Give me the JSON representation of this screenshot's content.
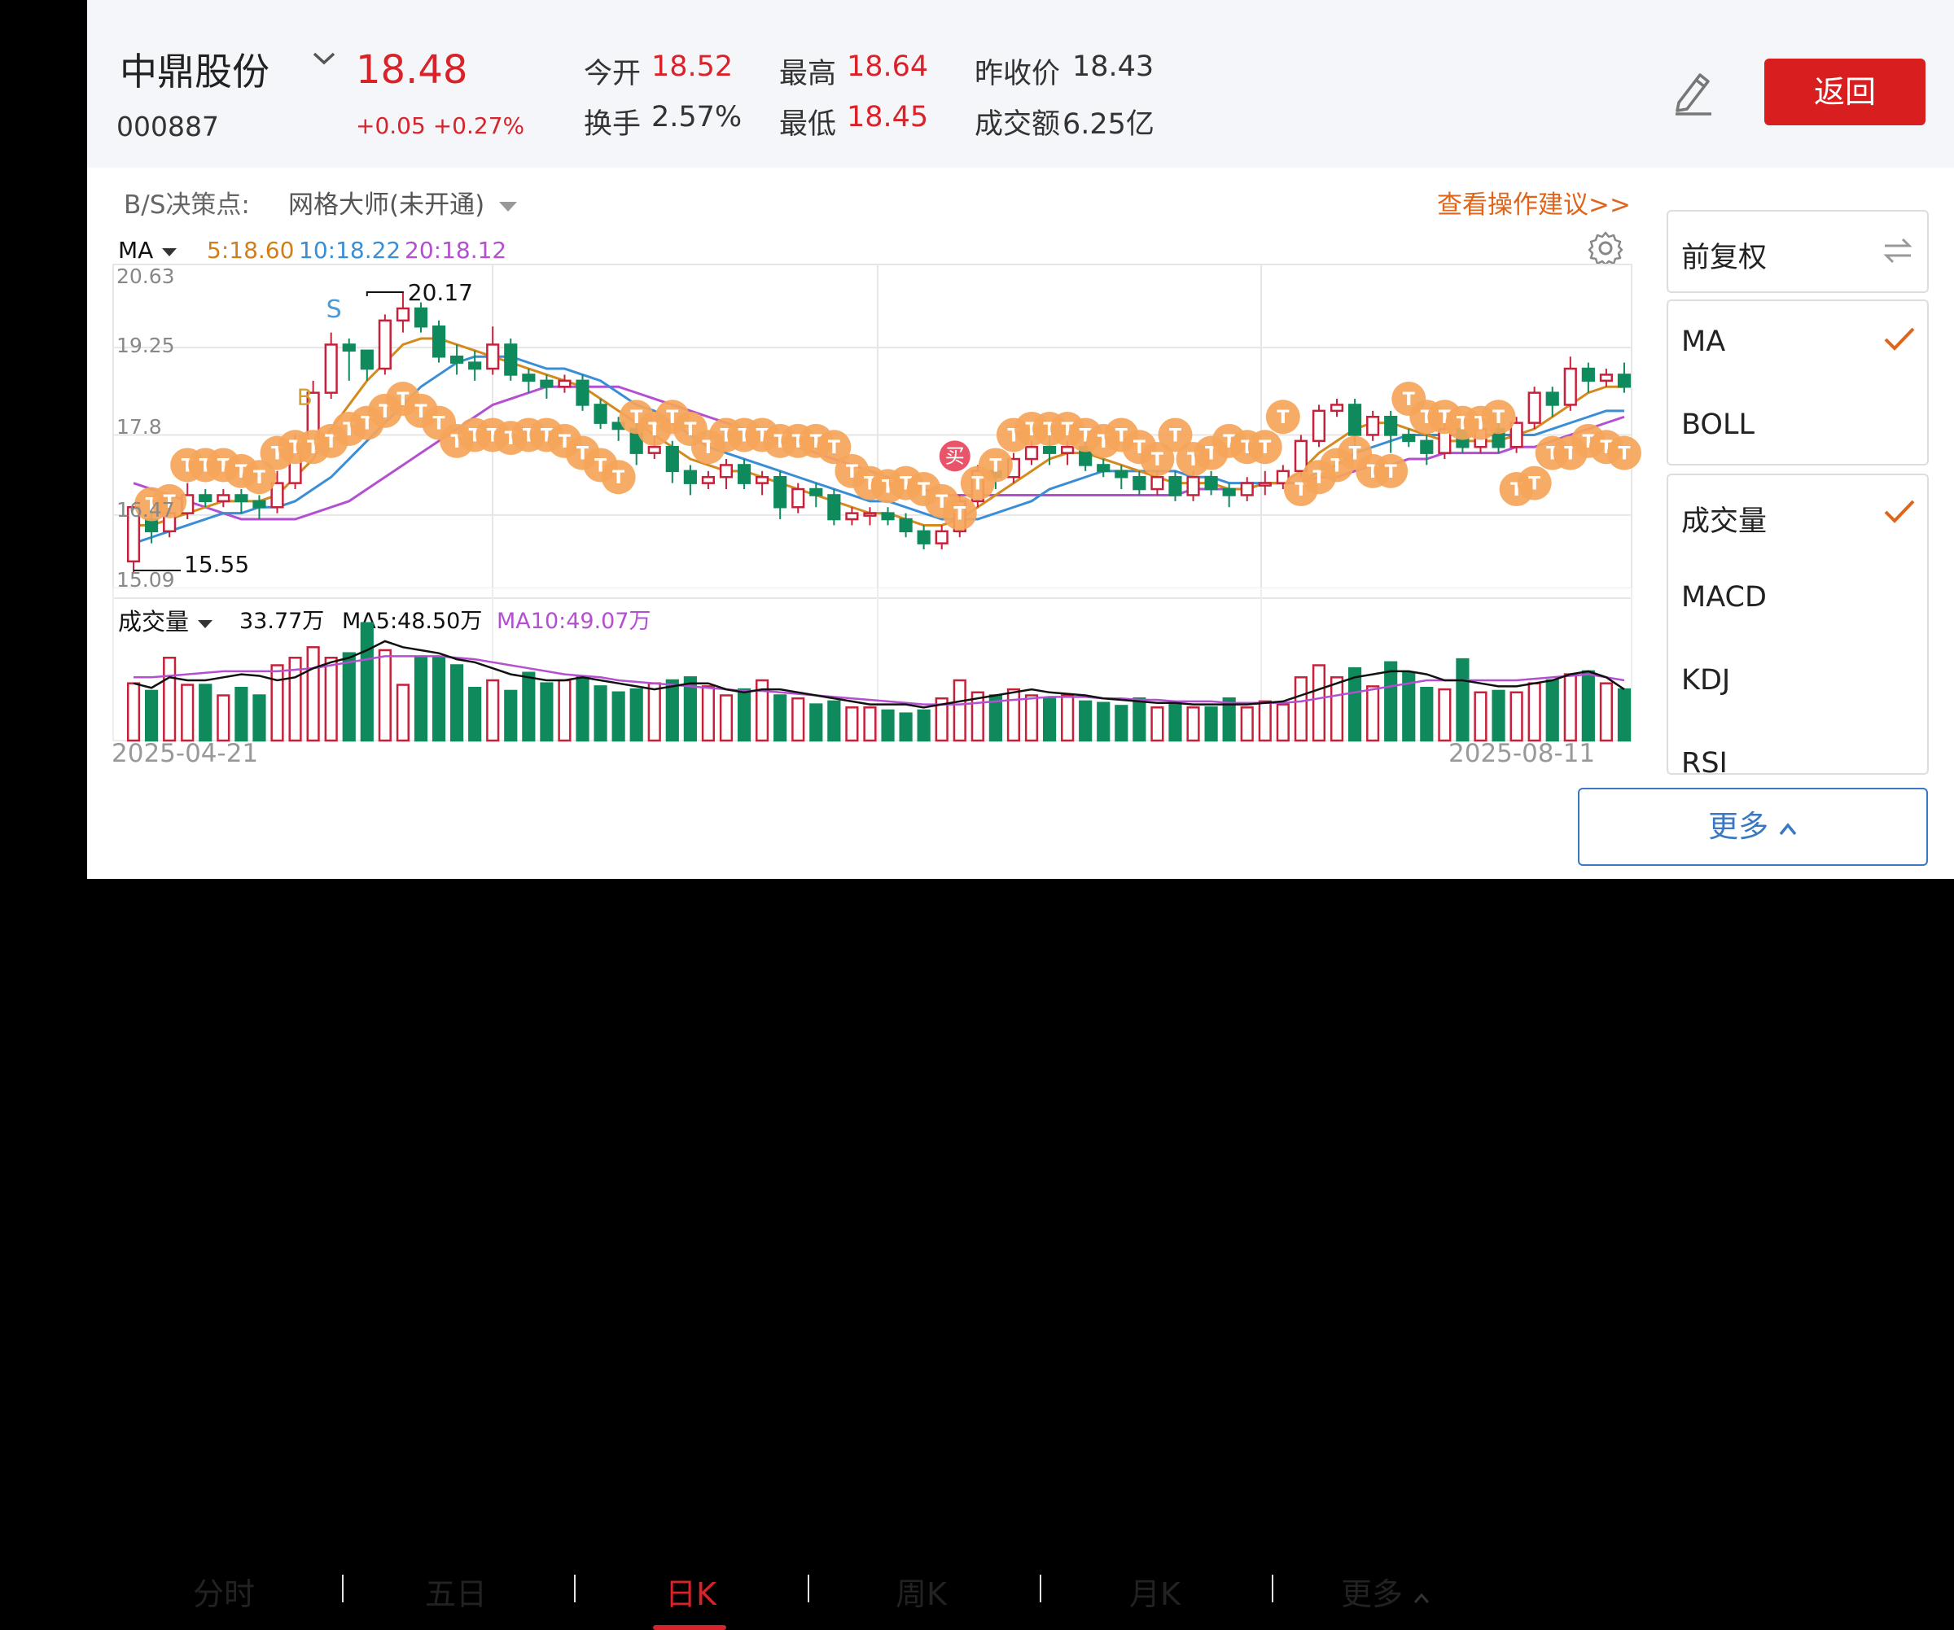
{
  "stock": {
    "name": "中鼎股份",
    "code": "000887",
    "price": "18.48",
    "change": "+0.05 +0.27%"
  },
  "stats": {
    "open_label": "今开",
    "open_value": "18.52",
    "high_label": "最高",
    "high_value": "18.64",
    "prev_close_label": "昨收价",
    "prev_close_value": "18.43",
    "turnover_label": "换手",
    "turnover_value": "2.57%",
    "low_label": "最低",
    "low_value": "18.45",
    "amount_label": "成交额",
    "amount_value": "6.25亿"
  },
  "header": {
    "back_label": "返回"
  },
  "decision": {
    "label": "B/S决策点:",
    "value": "网格大师(未开通)",
    "advice_link": "查看操作建议>>"
  },
  "indicator": {
    "name": "MA",
    "ma5": "5:18.60",
    "ma10": "10:18.22",
    "ma20": "20:18.12"
  },
  "chart_data": {
    "type": "candlestick",
    "y_ticks": [
      "20.63",
      "19.25",
      "17.8",
      "16.47",
      "15.09"
    ],
    "ylim": [
      15.09,
      20.63
    ],
    "max_label": "20.17",
    "min_label": "15.55",
    "markers": {
      "sell": "S",
      "buy": "B",
      "buy_badge": "买",
      "t_badge": "T"
    },
    "x_start": "2025-04-21",
    "x_end": "2025-08-11",
    "colors": {
      "up": "#c6213a",
      "down": "#0e8a5c",
      "ma5": "#d58a1f",
      "ma10": "#3a8ed6",
      "ma20": "#b44fd1",
      "t_marker": "#f5a55a",
      "buy_badge": "#e8556a"
    },
    "candles": [
      [
        15.7,
        16.6,
        15.5,
        16.4
      ],
      [
        16.4,
        16.2,
        16.0,
        16.5
      ],
      [
        16.2,
        16.5,
        16.1,
        16.7
      ],
      [
        16.5,
        16.8,
        16.4,
        17.0
      ],
      [
        16.8,
        16.7,
        16.6,
        16.9
      ],
      [
        16.7,
        16.8,
        16.6,
        16.9
      ],
      [
        16.8,
        16.7,
        16.5,
        16.9
      ],
      [
        16.7,
        16.6,
        16.4,
        16.8
      ],
      [
        16.6,
        17.0,
        16.5,
        17.2
      ],
      [
        17.0,
        17.6,
        16.9,
        17.8
      ],
      [
        17.6,
        18.5,
        17.5,
        18.7
      ],
      [
        18.5,
        19.3,
        18.4,
        19.5
      ],
      [
        19.3,
        19.2,
        18.7,
        19.4
      ],
      [
        19.2,
        18.9,
        18.7,
        19.2
      ],
      [
        18.9,
        19.7,
        18.8,
        19.8
      ],
      [
        19.7,
        19.9,
        19.5,
        20.17
      ],
      [
        19.9,
        19.6,
        19.5,
        20.0
      ],
      [
        19.6,
        19.1,
        19.0,
        19.7
      ],
      [
        19.1,
        19.0,
        18.8,
        19.3
      ],
      [
        19.0,
        18.9,
        18.7,
        19.2
      ],
      [
        18.9,
        19.3,
        18.8,
        19.6
      ],
      [
        19.3,
        18.8,
        18.7,
        19.4
      ],
      [
        18.8,
        18.7,
        18.5,
        18.9
      ],
      [
        18.7,
        18.6,
        18.4,
        18.8
      ],
      [
        18.6,
        18.7,
        18.5,
        18.8
      ],
      [
        18.7,
        18.3,
        18.2,
        18.8
      ],
      [
        18.3,
        18.0,
        17.9,
        18.4
      ],
      [
        18.0,
        17.9,
        17.7,
        18.1
      ],
      [
        17.9,
        17.5,
        17.3,
        18.0
      ],
      [
        17.5,
        17.6,
        17.4,
        17.8
      ],
      [
        17.6,
        17.2,
        17.0,
        17.7
      ],
      [
        17.2,
        17.0,
        16.8,
        17.3
      ],
      [
        17.0,
        17.1,
        16.9,
        17.2
      ],
      [
        17.1,
        17.3,
        16.9,
        17.4
      ],
      [
        17.3,
        17.0,
        16.9,
        17.4
      ],
      [
        17.0,
        17.1,
        16.8,
        17.2
      ],
      [
        17.1,
        16.6,
        16.4,
        17.2
      ],
      [
        16.6,
        16.9,
        16.5,
        17.0
      ],
      [
        16.9,
        16.8,
        16.6,
        17.0
      ],
      [
        16.8,
        16.4,
        16.3,
        16.9
      ],
      [
        16.4,
        16.5,
        16.3,
        16.6
      ],
      [
        16.5,
        16.5,
        16.3,
        16.6
      ],
      [
        16.5,
        16.4,
        16.3,
        16.6
      ],
      [
        16.4,
        16.2,
        16.1,
        16.5
      ],
      [
        16.2,
        16.0,
        15.9,
        16.3
      ],
      [
        16.0,
        16.2,
        15.9,
        16.3
      ],
      [
        16.2,
        16.7,
        16.1,
        16.8
      ],
      [
        16.7,
        17.2,
        16.6,
        17.3
      ],
      [
        17.2,
        17.1,
        16.9,
        17.4
      ],
      [
        17.1,
        17.4,
        17.0,
        17.5
      ],
      [
        17.4,
        17.6,
        17.3,
        17.7
      ],
      [
        17.6,
        17.5,
        17.3,
        17.8
      ],
      [
        17.5,
        17.6,
        17.3,
        17.7
      ],
      [
        17.6,
        17.3,
        17.2,
        17.7
      ],
      [
        17.3,
        17.2,
        17.1,
        17.4
      ],
      [
        17.2,
        17.1,
        16.9,
        17.3
      ],
      [
        17.1,
        16.9,
        16.8,
        17.2
      ],
      [
        16.9,
        17.1,
        16.8,
        17.2
      ],
      [
        17.1,
        16.8,
        16.7,
        17.2
      ],
      [
        16.8,
        17.1,
        16.7,
        17.2
      ],
      [
        17.1,
        16.9,
        16.8,
        17.2
      ],
      [
        16.9,
        16.8,
        16.6,
        17.0
      ],
      [
        16.8,
        17.0,
        16.7,
        17.1
      ],
      [
        17.0,
        17.0,
        16.8,
        17.2
      ],
      [
        17.0,
        17.2,
        16.9,
        17.3
      ],
      [
        17.2,
        17.7,
        17.1,
        17.8
      ],
      [
        17.7,
        18.2,
        17.6,
        18.3
      ],
      [
        18.2,
        18.3,
        18.1,
        18.4
      ],
      [
        18.3,
        17.8,
        17.6,
        18.4
      ],
      [
        17.8,
        18.1,
        17.7,
        18.2
      ],
      [
        18.1,
        17.8,
        17.5,
        18.2
      ],
      [
        17.8,
        17.7,
        17.6,
        17.9
      ],
      [
        17.7,
        17.5,
        17.3,
        17.8
      ],
      [
        17.5,
        17.9,
        17.4,
        18.0
      ],
      [
        17.9,
        17.6,
        17.5,
        18.0
      ],
      [
        17.6,
        17.9,
        17.5,
        18.1
      ],
      [
        17.9,
        17.6,
        17.5,
        18.0
      ],
      [
        17.6,
        18.0,
        17.5,
        18.1
      ],
      [
        18.0,
        18.5,
        17.9,
        18.6
      ],
      [
        18.5,
        18.3,
        18.1,
        18.6
      ],
      [
        18.3,
        18.9,
        18.2,
        19.1
      ],
      [
        18.9,
        18.7,
        18.5,
        19.0
      ],
      [
        18.7,
        18.8,
        18.6,
        18.9
      ],
      [
        18.8,
        18.6,
        18.5,
        19.0
      ]
    ],
    "ma5": [
      16.3,
      16.3,
      16.4,
      16.5,
      16.6,
      16.7,
      16.7,
      16.7,
      16.8,
      17.1,
      17.4,
      17.9,
      18.3,
      18.7,
      19.0,
      19.3,
      19.4,
      19.4,
      19.3,
      19.2,
      19.1,
      19.0,
      18.9,
      18.8,
      18.7,
      18.6,
      18.4,
      18.2,
      18.0,
      17.8,
      17.6,
      17.4,
      17.3,
      17.2,
      17.2,
      17.1,
      17.0,
      16.9,
      16.8,
      16.7,
      16.6,
      16.5,
      16.5,
      16.4,
      16.3,
      16.3,
      16.4,
      16.6,
      16.8,
      17.0,
      17.2,
      17.4,
      17.5,
      17.5,
      17.4,
      17.3,
      17.2,
      17.1,
      17.0,
      17.0,
      17.0,
      16.9,
      16.9,
      17.0,
      17.0,
      17.2,
      17.5,
      17.7,
      17.9,
      18.0,
      18.0,
      17.9,
      17.8,
      17.7,
      17.7,
      17.7,
      17.7,
      17.8,
      17.9,
      18.1,
      18.3,
      18.5,
      18.6,
      18.6
    ],
    "ma10": [
      16.0,
      16.1,
      16.2,
      16.3,
      16.4,
      16.5,
      16.5,
      16.6,
      16.6,
      16.7,
      16.9,
      17.1,
      17.4,
      17.7,
      18.0,
      18.3,
      18.6,
      18.8,
      19.0,
      19.1,
      19.1,
      19.1,
      19.0,
      18.9,
      18.9,
      18.8,
      18.7,
      18.5,
      18.3,
      18.2,
      18.0,
      17.8,
      17.6,
      17.5,
      17.4,
      17.3,
      17.2,
      17.1,
      17.0,
      16.9,
      16.8,
      16.7,
      16.7,
      16.6,
      16.5,
      16.4,
      16.4,
      16.4,
      16.5,
      16.6,
      16.7,
      16.9,
      17.0,
      17.1,
      17.2,
      17.2,
      17.2,
      17.2,
      17.2,
      17.1,
      17.1,
      17.0,
      17.0,
      17.0,
      17.0,
      17.0,
      17.2,
      17.3,
      17.5,
      17.6,
      17.7,
      17.8,
      17.8,
      17.8,
      17.8,
      17.8,
      17.8,
      17.8,
      17.8,
      17.9,
      18.0,
      18.1,
      18.2,
      18.2
    ],
    "ma20": [
      17.0,
      16.9,
      16.8,
      16.7,
      16.6,
      16.5,
      16.4,
      16.4,
      16.4,
      16.4,
      16.5,
      16.6,
      16.7,
      16.9,
      17.1,
      17.3,
      17.5,
      17.7,
      17.9,
      18.1,
      18.3,
      18.4,
      18.5,
      18.6,
      18.6,
      18.6,
      18.6,
      18.6,
      18.5,
      18.4,
      18.3,
      18.2,
      18.1,
      18.0,
      17.9,
      17.8,
      17.7,
      17.6,
      17.5,
      17.4,
      17.3,
      17.2,
      17.1,
      17.0,
      16.9,
      16.8,
      16.8,
      16.8,
      16.8,
      16.8,
      16.8,
      16.8,
      16.8,
      16.8,
      16.8,
      16.8,
      16.8,
      16.8,
      16.8,
      16.9,
      16.9,
      16.9,
      16.9,
      17.0,
      17.0,
      17.0,
      17.1,
      17.1,
      17.2,
      17.3,
      17.3,
      17.4,
      17.4,
      17.5,
      17.5,
      17.5,
      17.5,
      17.6,
      17.6,
      17.7,
      17.8,
      17.9,
      18.0,
      18.1
    ],
    "t_markers": [
      [
        1,
        16.65
      ],
      [
        2,
        16.7
      ],
      [
        3,
        17.3
      ],
      [
        4,
        17.3
      ],
      [
        5,
        17.3
      ],
      [
        6,
        17.2
      ],
      [
        7,
        17.1
      ],
      [
        8,
        17.5
      ],
      [
        9,
        17.6
      ],
      [
        10,
        17.6
      ],
      [
        11,
        17.7
      ],
      [
        12,
        17.9
      ],
      [
        13,
        18.0
      ],
      [
        14,
        18.2
      ],
      [
        15,
        18.4
      ],
      [
        16,
        18.2
      ],
      [
        17,
        18.0
      ],
      [
        18,
        17.7
      ],
      [
        19,
        17.8
      ],
      [
        20,
        17.8
      ],
      [
        21,
        17.75
      ],
      [
        22,
        17.8
      ],
      [
        23,
        17.8
      ],
      [
        24,
        17.7
      ],
      [
        25,
        17.5
      ],
      [
        26,
        17.3
      ],
      [
        27,
        17.1
      ],
      [
        28,
        18.1
      ],
      [
        29,
        17.9
      ],
      [
        30,
        18.1
      ],
      [
        31,
        17.9
      ],
      [
        32,
        17.6
      ],
      [
        33,
        17.8
      ],
      [
        34,
        17.8
      ],
      [
        35,
        17.8
      ],
      [
        36,
        17.7
      ],
      [
        37,
        17.7
      ],
      [
        38,
        17.7
      ],
      [
        39,
        17.6
      ],
      [
        40,
        17.2
      ],
      [
        41,
        17.0
      ],
      [
        42,
        16.95
      ],
      [
        43,
        17.0
      ],
      [
        44,
        16.9
      ],
      [
        45,
        16.7
      ],
      [
        46,
        16.5
      ],
      [
        47,
        17.0
      ],
      [
        48,
        17.3
      ],
      [
        49,
        17.8
      ],
      [
        50,
        17.9
      ],
      [
        51,
        17.9
      ],
      [
        52,
        17.9
      ],
      [
        53,
        17.8
      ],
      [
        54,
        17.7
      ],
      [
        55,
        17.8
      ],
      [
        56,
        17.6
      ],
      [
        57,
        17.4
      ],
      [
        58,
        17.8
      ],
      [
        59,
        17.4
      ],
      [
        60,
        17.5
      ],
      [
        61,
        17.7
      ],
      [
        62,
        17.6
      ],
      [
        63,
        17.6
      ],
      [
        64,
        18.1
      ],
      [
        65,
        16.9
      ],
      [
        66,
        17.1
      ],
      [
        67,
        17.3
      ],
      [
        68,
        17.5
      ],
      [
        69,
        17.2
      ],
      [
        70,
        17.2
      ],
      [
        71,
        18.4
      ],
      [
        72,
        18.1
      ],
      [
        73,
        18.1
      ],
      [
        74,
        18.0
      ],
      [
        75,
        18.0
      ],
      [
        76,
        18.1
      ],
      [
        77,
        16.9
      ],
      [
        78,
        17.0
      ],
      [
        79,
        17.5
      ],
      [
        80,
        17.5
      ],
      [
        81,
        17.7
      ],
      [
        82,
        17.6
      ],
      [
        83,
        17.5
      ]
    ],
    "volume": {
      "label": "成交量",
      "current": "33.77万",
      "ma5": "MA5:48.50万",
      "ma10": "MA10:49.07万",
      "ylim": [
        0,
        80
      ],
      "values": [
        38,
        33,
        55,
        37,
        37,
        30,
        35,
        30,
        50,
        55,
        62,
        55,
        58,
        78,
        60,
        37,
        55,
        55,
        50,
        35,
        40,
        33,
        45,
        38,
        40,
        42,
        36,
        32,
        34,
        38,
        40,
        42,
        36,
        30,
        34,
        40,
        30,
        28,
        24,
        26,
        22,
        22,
        20,
        18,
        20,
        28,
        40,
        32,
        30,
        34,
        30,
        28,
        30,
        26,
        25,
        23,
        28,
        22,
        24,
        22,
        22,
        28,
        22,
        26,
        24,
        42,
        50,
        42,
        48,
        36,
        52,
        45,
        35,
        34,
        54,
        32,
        33,
        32,
        38,
        40,
        44,
        46,
        38,
        34
      ],
      "ma5_line": [
        38,
        35,
        42,
        40,
        40,
        42,
        44,
        43,
        40,
        42,
        48,
        52,
        55,
        60,
        66,
        62,
        60,
        58,
        54,
        52,
        48,
        44,
        42,
        40,
        40,
        42,
        40,
        38,
        36,
        34,
        36,
        38,
        38,
        34,
        32,
        34,
        34,
        32,
        30,
        28,
        26,
        24,
        24,
        24,
        22,
        24,
        26,
        28,
        30,
        32,
        34,
        32,
        31,
        30,
        28,
        27,
        26,
        25,
        25,
        24,
        24,
        24,
        24,
        25,
        26,
        30,
        34,
        38,
        42,
        44,
        46,
        46,
        44,
        40,
        40,
        38,
        36,
        36,
        38,
        40,
        44,
        46,
        42,
        34
      ],
      "ma10_line": [
        42,
        42,
        43,
        44,
        45,
        46,
        46,
        46,
        46,
        47,
        48,
        50,
        52,
        54,
        56,
        56,
        56,
        56,
        55,
        54,
        52,
        50,
        48,
        46,
        44,
        43,
        42,
        40,
        39,
        38,
        37,
        36,
        35,
        34,
        33,
        33,
        32,
        31,
        30,
        29,
        28,
        27,
        26,
        25,
        24,
        24,
        24,
        25,
        26,
        27,
        28,
        29,
        29,
        29,
        28,
        28,
        27,
        27,
        26,
        26,
        26,
        25,
        25,
        25,
        25,
        26,
        28,
        30,
        32,
        34,
        36,
        38,
        40,
        40,
        40,
        40,
        40,
        40,
        41,
        42,
        43,
        44,
        42,
        40
      ]
    }
  },
  "tabs": [
    {
      "label": "分时"
    },
    {
      "label": "五日"
    },
    {
      "label": "日K"
    },
    {
      "label": "周K"
    },
    {
      "label": "月K"
    },
    {
      "label": "更多"
    }
  ],
  "side_panel": {
    "adjust": "前复权",
    "main_indicators": [
      {
        "label": "MA",
        "checked": true
      },
      {
        "label": "BOLL",
        "checked": false
      }
    ],
    "sub_indicators": [
      {
        "label": "成交量",
        "checked": true
      },
      {
        "label": "MACD",
        "checked": false
      },
      {
        "label": "KDJ",
        "checked": false
      },
      {
        "label": "RSI",
        "checked": false
      }
    ],
    "more_label": "更多"
  }
}
